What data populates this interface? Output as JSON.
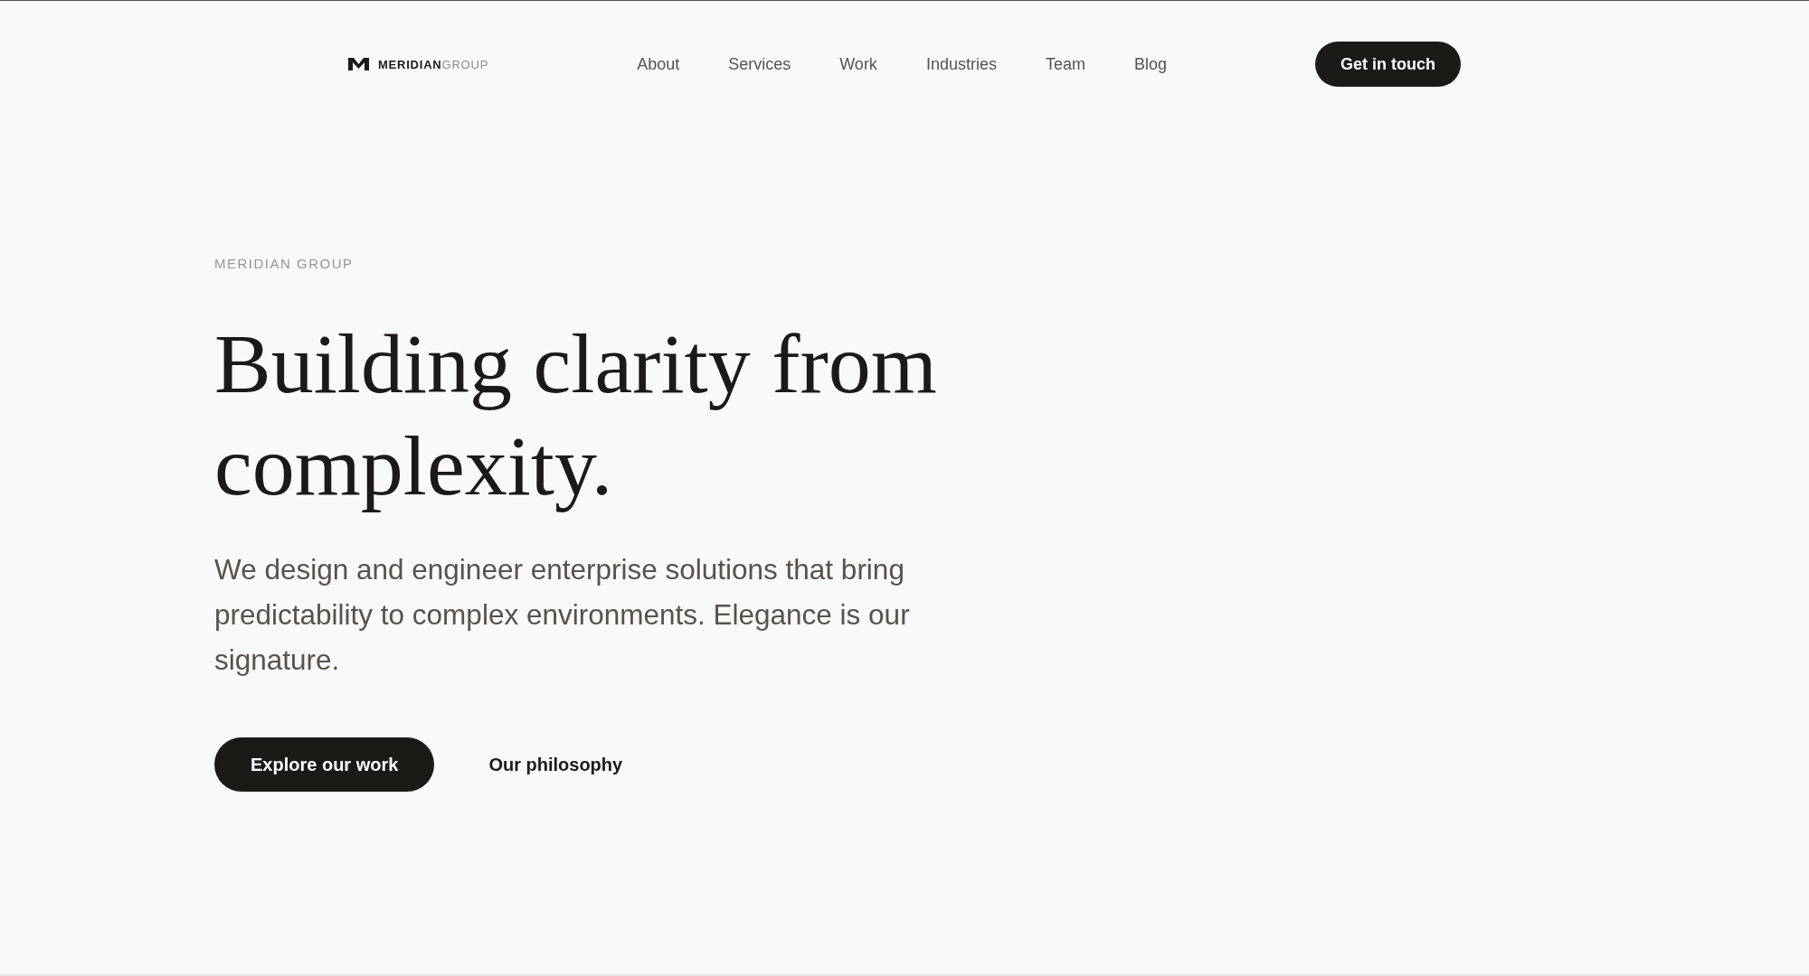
{
  "header": {
    "logo": {
      "primary": "MERIDIAN",
      "secondary": "GROUP"
    },
    "nav": [
      {
        "label": "About"
      },
      {
        "label": "Services"
      },
      {
        "label": "Work"
      },
      {
        "label": "Industries"
      },
      {
        "label": "Team"
      },
      {
        "label": "Blog"
      }
    ],
    "cta": "Get in touch"
  },
  "hero": {
    "eyebrow": "MERIDIAN GROUP",
    "headline": "Building clarity from complexity.",
    "description": "We design and engineer enterprise solutions that bring predictability to complex environments. Elegance is our signature.",
    "actions": [
      {
        "label": "Explore our work",
        "kind": "primary"
      },
      {
        "label": "Our philosophy",
        "kind": "secondary"
      }
    ]
  }
}
